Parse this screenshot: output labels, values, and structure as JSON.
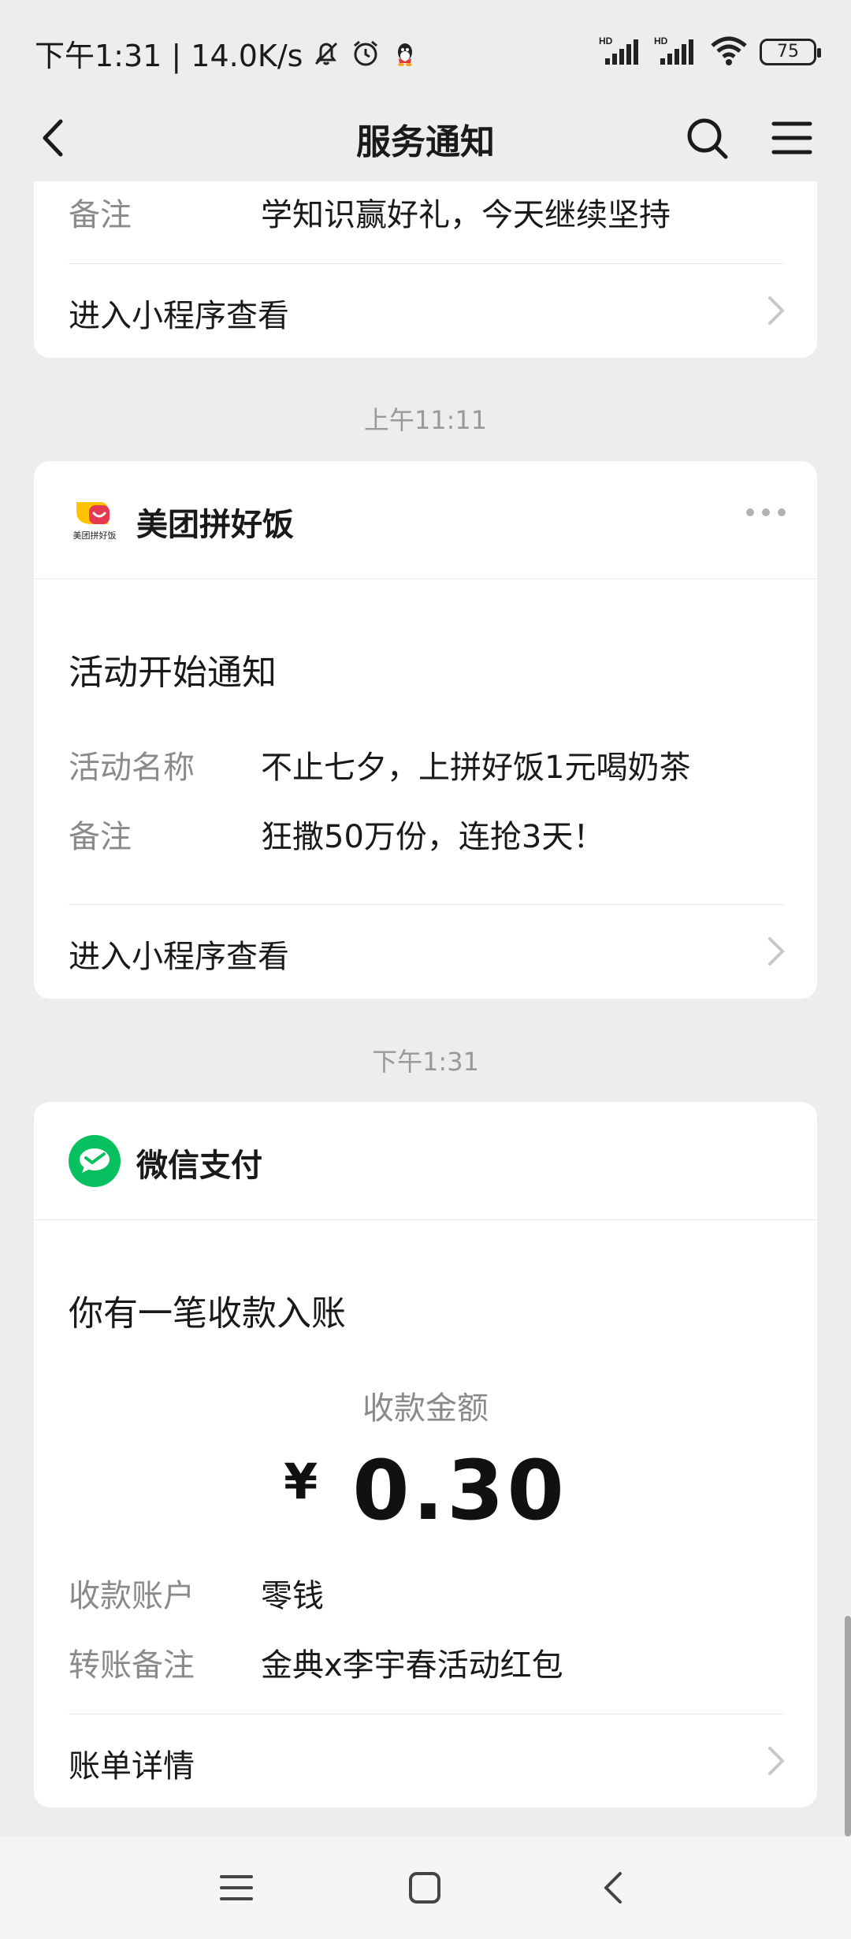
{
  "status_bar": {
    "time_speed": "下午1:31 | 14.0K/s",
    "battery": "75",
    "signal_label": "HD"
  },
  "nav": {
    "title": "服务通知"
  },
  "cards": {
    "first": {
      "partial_label": "备注",
      "partial_value": "学知识赢好礼，今天继续坚持",
      "link": "进入小程序查看"
    },
    "meituan": {
      "timestamp": "上午11:11",
      "source": "美团拼好饭",
      "logo_text": "美团拼好饭",
      "title": "活动开始通知",
      "rows": [
        {
          "label": "活动名称",
          "value": "不止七夕，上拼好饭1元喝奶茶"
        },
        {
          "label": "备注",
          "value": "狂撒50万份，连抢3天！"
        }
      ],
      "link": "进入小程序查看"
    },
    "wechat_pay": {
      "timestamp": "下午1:31",
      "source": "微信支付",
      "title": "你有一笔收款入账",
      "amount_label": "收款金额",
      "currency": "¥",
      "amount": "0.30",
      "rows": [
        {
          "label": "收款账户",
          "value": "零钱"
        },
        {
          "label": "转账备注",
          "value": "金典x李宇春活动红包"
        }
      ],
      "link": "账单详情"
    }
  },
  "colors": {
    "background": "#ededed",
    "card": "#ffffff",
    "wechat_green": "#07c160",
    "meituan_yellow": "#ffc300"
  }
}
